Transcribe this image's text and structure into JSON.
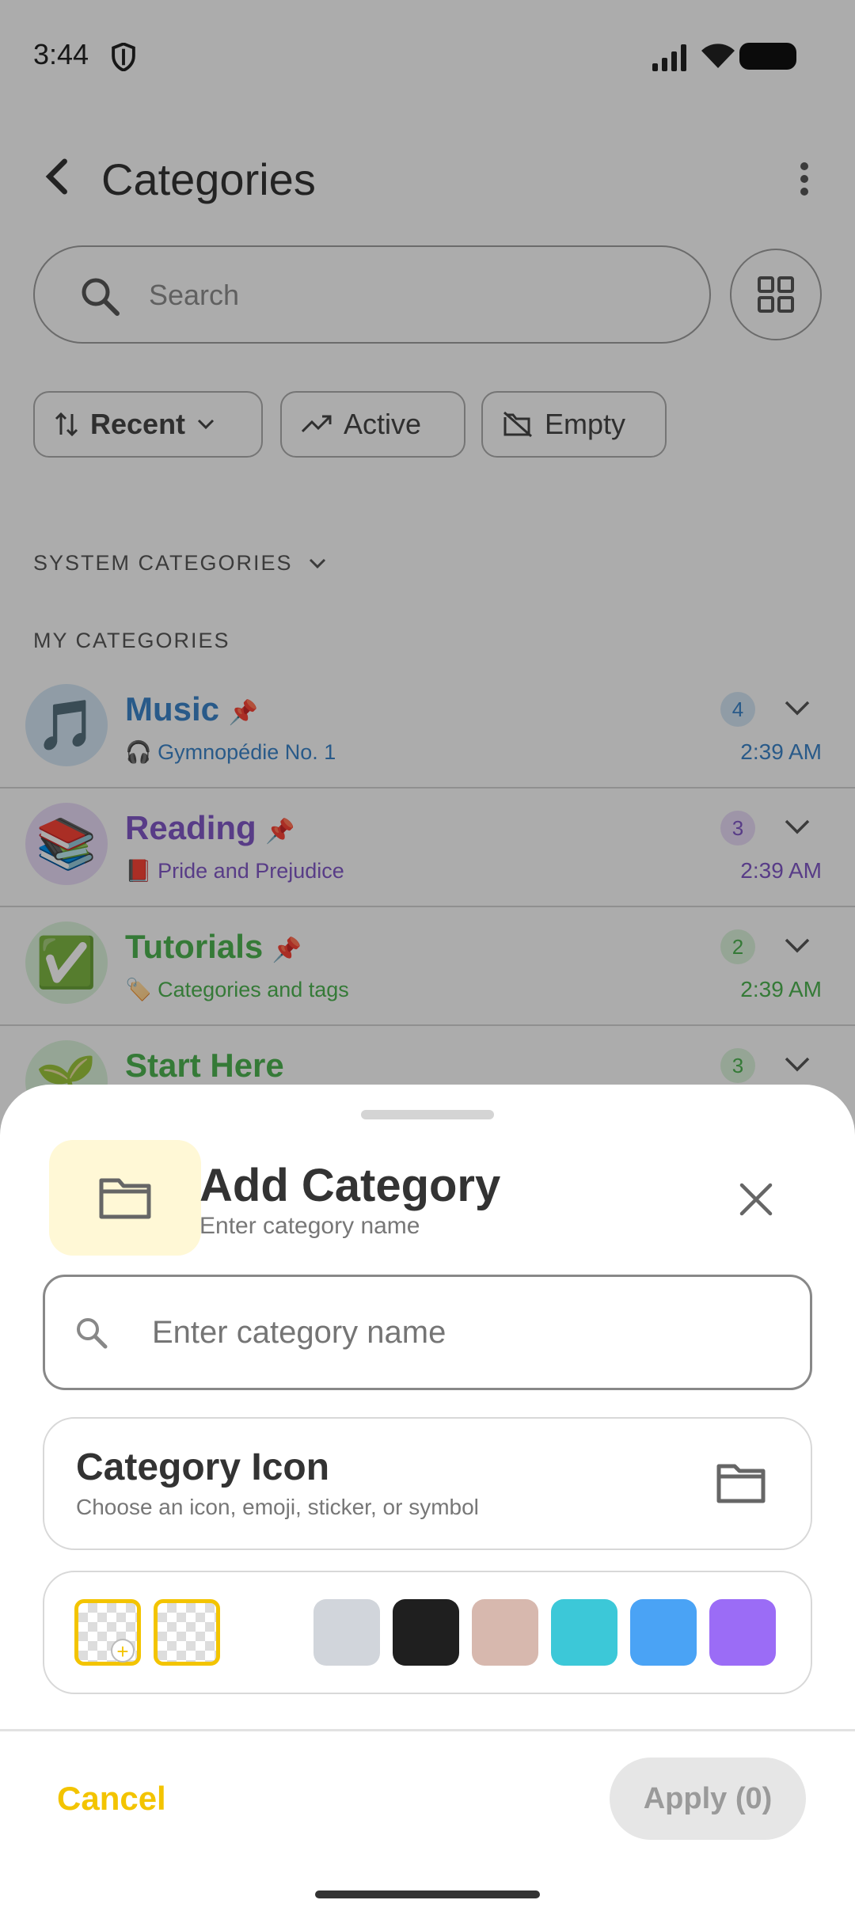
{
  "status": {
    "time": "3:44"
  },
  "header": {
    "title": "Categories"
  },
  "search": {
    "placeholder": "Search"
  },
  "filters": {
    "sort_label": "Recent",
    "active_label": "Active",
    "empty_label": "Empty"
  },
  "sections": {
    "system": "SYSTEM CATEGORIES",
    "mine": "MY CATEGORIES"
  },
  "categories": [
    {
      "emoji": "🎵",
      "name": "Music",
      "sub_emoji": "🎧",
      "subtitle": "Gymnopédie No. 1",
      "count": "4",
      "time": "2:39 AM",
      "color": "#3b82c4",
      "tint": "#cfe0ee"
    },
    {
      "emoji": "📚",
      "name": "Reading",
      "sub_emoji": "📕",
      "subtitle": "Pride and Prejudice",
      "count": "3",
      "time": "2:39 AM",
      "color": "#7e57c2",
      "tint": "#e3d6f1"
    },
    {
      "emoji": "✅",
      "name": "Tutorials",
      "sub_emoji": "🏷️",
      "subtitle": "Categories and tags",
      "count": "2",
      "time": "2:39 AM",
      "color": "#4caf50",
      "tint": "#d6ecd6"
    },
    {
      "emoji": "🌱",
      "name": "Start Here",
      "count": "3",
      "color": "#4caf50",
      "tint": "#d6ecd6"
    }
  ],
  "sheet": {
    "title": "Add Category",
    "subtitle": "Enter category name",
    "input_placeholder": "Enter category name",
    "icon_title": "Category Icon",
    "icon_subtitle": "Choose an icon, emoji, sticker, or symbol",
    "swatches": [
      "#d1d5db",
      "#1f1f1f",
      "#d7b8ae",
      "#3cc8d8",
      "#4aa3f5",
      "#9b6cf6"
    ],
    "cancel_label": "Cancel",
    "apply_label": "Apply (0)"
  },
  "colors": {
    "accent": "#f3c400",
    "pin": "#e0b000"
  }
}
